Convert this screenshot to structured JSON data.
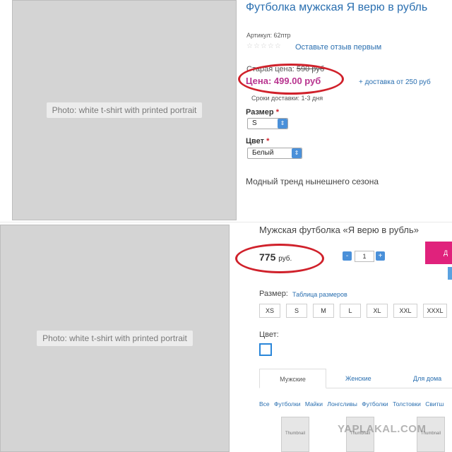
{
  "top": {
    "photo_label": "Photo: white t-shirt with printed portrait",
    "title": "Футболка мужская Я верю в рубль",
    "sku": "Артикул: 62птр",
    "stars": "☆☆☆☆☆",
    "review_link": "Оставьте отзыв первым",
    "old_price_label": "Старая цена:",
    "old_price": "590 руб",
    "price": "Цена: 499.00 руб",
    "delivery": "+ доставка от 250 руб",
    "terms": "Сроки доставки: 1-3 дня",
    "size_label": "Размер",
    "size_value": "S",
    "color_label": "Цвет",
    "color_value": "Белый",
    "required_mark": "*",
    "description": "Модный тренд нынешнего сезона"
  },
  "bottom": {
    "photo_label": "Photo: white t-shirt with printed portrait",
    "title": "Мужская футболка «Я верю в рубль»",
    "price": "775",
    "currency": "руб.",
    "qty_minus": "-",
    "qty_value": "1",
    "qty_plus": "+",
    "cart_label": "Д",
    "size_label": "Размер:",
    "size_chart_link": "Таблица размеров",
    "sizes": [
      "XS",
      "S",
      "M",
      "L",
      "XL",
      "XXL",
      "XXXL"
    ],
    "color_label": "Цвет:",
    "tabs": [
      "Мужские",
      "Женские",
      "Для дома"
    ],
    "categories": [
      "Все",
      "Футболки",
      "Майки",
      "Лонгсливы",
      "Футболки",
      "Толстовки",
      "Свитш"
    ],
    "thumb_label": "Thumbnail",
    "watermark": "YAPLAKAL.COM"
  },
  "colors": {
    "link": "#2a6fb0",
    "price": "#b8348f",
    "highlight_oval": "#d0212b",
    "accent_button": "#e0227c",
    "stepper": "#4a90d9"
  }
}
